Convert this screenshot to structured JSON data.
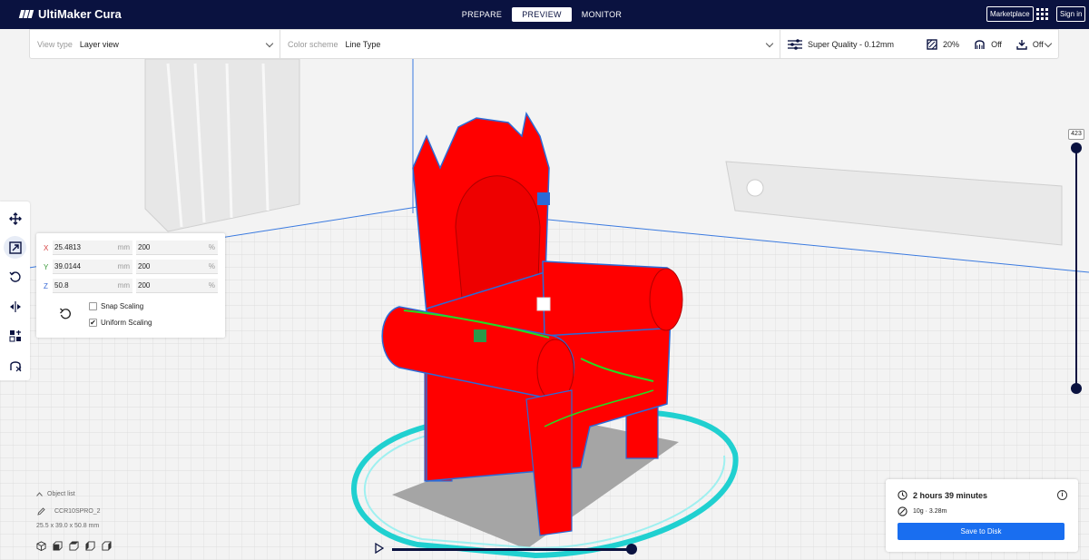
{
  "app": {
    "title": "UltiMaker Cura"
  },
  "stages": [
    {
      "label": "PREPARE",
      "active": false
    },
    {
      "label": "PREVIEW",
      "active": true
    },
    {
      "label": "MONITOR",
      "active": false
    }
  ],
  "header": {
    "marketplace": "Marketplace",
    "sign_in": "Sign in"
  },
  "viewbar": {
    "view_type_label": "View type",
    "view_type_value": "Layer view",
    "color_scheme_label": "Color scheme",
    "color_scheme_value": "Line Type",
    "profile": "Super Quality - 0.12mm",
    "infill": "20%",
    "support": "Off",
    "adhesion": "Off"
  },
  "scale_panel": {
    "x": {
      "axis": "X",
      "mm": "25.4813",
      "mm_unit": "mm",
      "percent": "200",
      "pct_unit": "%"
    },
    "y": {
      "axis": "Y",
      "mm": "39.0144",
      "mm_unit": "mm",
      "percent": "200",
      "pct_unit": "%"
    },
    "z": {
      "axis": "Z",
      "mm": "50.8",
      "mm_unit": "mm",
      "percent": "200",
      "pct_unit": "%"
    },
    "snap_scaling": {
      "label": "Snap Scaling",
      "checked": false
    },
    "uniform_scaling": {
      "label": "Uniform Scaling",
      "checked": true
    }
  },
  "layer_slider": {
    "value": "423"
  },
  "object_list": {
    "header": "Object list",
    "name": "CCR10SPRO_2",
    "dimensions": "25.5 x 39.0 x 50.8 mm"
  },
  "print_info": {
    "time": "2 hours 39 minutes",
    "material": "10g · 3.28m",
    "save_label": "Save to Disk"
  },
  "colors": {
    "header_bg": "#0a1240",
    "accent": "#196ef0",
    "model_red": "#ff0000",
    "travel_cyan": "#20d0d0"
  }
}
